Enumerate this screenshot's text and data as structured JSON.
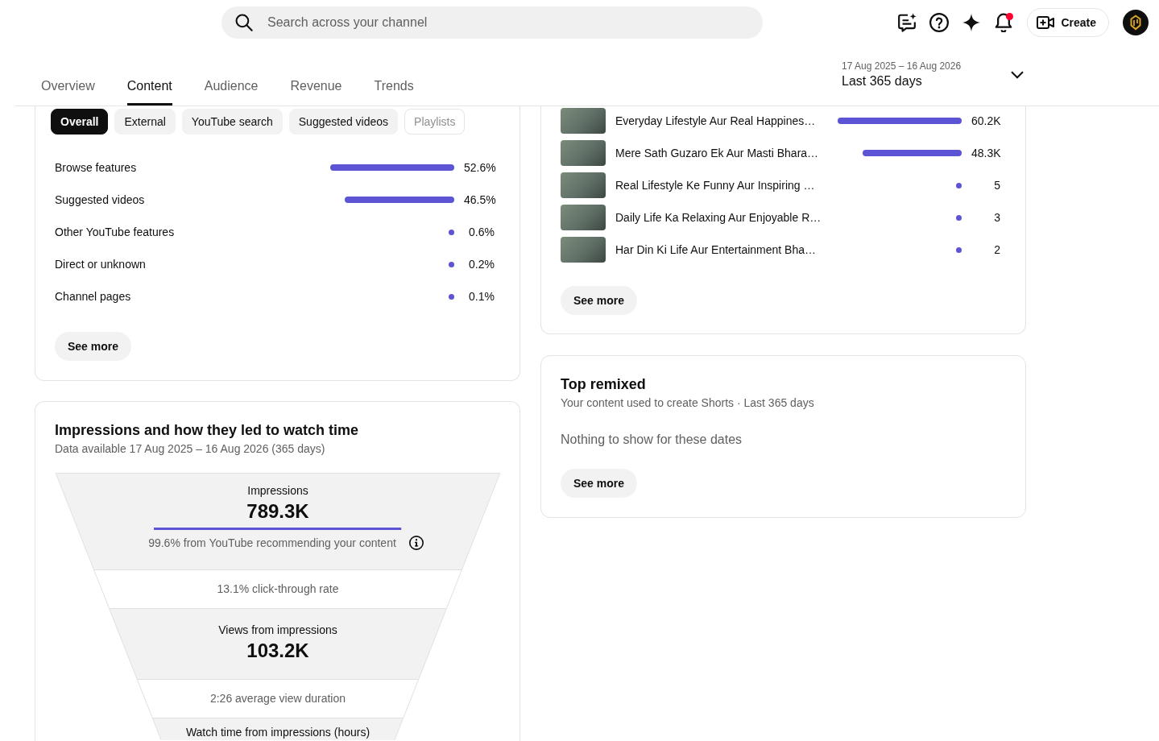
{
  "search": {
    "placeholder": "Search across your channel"
  },
  "toolbar": {
    "notifications": {
      "unread": true
    },
    "create_button": "Create"
  },
  "tabs": [
    {
      "label": "Overview",
      "selected": false
    },
    {
      "label": "Content",
      "selected": true
    },
    {
      "label": "Audience",
      "selected": false
    },
    {
      "label": "Revenue",
      "selected": false
    },
    {
      "label": "Trends",
      "selected": false
    }
  ],
  "date_range": {
    "dates": "17 Aug 2025 – 16 Aug 2026",
    "period": "Last 365 days"
  },
  "traffic_sources": {
    "filters": [
      {
        "label": "Overall",
        "selected": true,
        "disabled": false
      },
      {
        "label": "External",
        "selected": false,
        "disabled": false
      },
      {
        "label": "YouTube search",
        "selected": false,
        "disabled": false
      },
      {
        "label": "Suggested videos",
        "selected": false,
        "disabled": false
      },
      {
        "label": "Playlists",
        "selected": false,
        "disabled": true
      }
    ],
    "rows": [
      {
        "name": "Browse features",
        "kind": "bar",
        "level": 1,
        "share": "52.6%"
      },
      {
        "name": "Suggested videos",
        "kind": "bar",
        "level": 0.884,
        "share": "46.5%"
      },
      {
        "name": "Other YouTube features",
        "kind": "dot",
        "share": "0.6%"
      },
      {
        "name": "Direct or unknown",
        "kind": "dot",
        "share": "0.2%"
      },
      {
        "name": "Channel pages",
        "kind": "dot",
        "share": "0.1%"
      }
    ],
    "see_more": "See more"
  },
  "top_content": {
    "videos": [
      {
        "title": "Everyday Lifestyle Aur Real Happines…",
        "kind": "bar",
        "level": 1,
        "views": "60.2K"
      },
      {
        "title": "Mere Sath Guzaro Ek Aur Masti Bhara…",
        "kind": "bar",
        "level": 0.802,
        "views": "48.3K"
      },
      {
        "title": "Real Lifestyle Ke Funny Aur Inspiring …",
        "kind": "dot",
        "views": "5"
      },
      {
        "title": "Daily Life Ka Relaxing Aur Enjoyable R…",
        "kind": "dot",
        "views": "3"
      },
      {
        "title": "Har Din Ki Life Aur Entertainment Bha…",
        "kind": "dot",
        "views": "2"
      }
    ],
    "see_more": "See more"
  },
  "impressions": {
    "title": "Impressions and how they led to watch time",
    "subtitle": "Data available 17 Aug 2025 – 16 Aug 2026 (365 days)",
    "funnel": [
      {
        "kind": "metric",
        "label": "Impressions",
        "value": "789.3K",
        "level": 0.996,
        "note": "99.6% from YouTube recommending your content"
      },
      {
        "kind": "rate",
        "text": "13.1% click-through rate"
      },
      {
        "kind": "metric",
        "label": "Views from impressions",
        "value": "103.2K"
      },
      {
        "kind": "rate",
        "text": "2:26 average view duration"
      },
      {
        "kind": "metric",
        "label": "Watch time from impressions (hours)"
      }
    ]
  },
  "top_remixed": {
    "title": "Top remixed",
    "subtitle": "Your content used to create Shorts · Last 365 days",
    "message": "Nothing to show for these dates",
    "see_more": "See more"
  }
}
